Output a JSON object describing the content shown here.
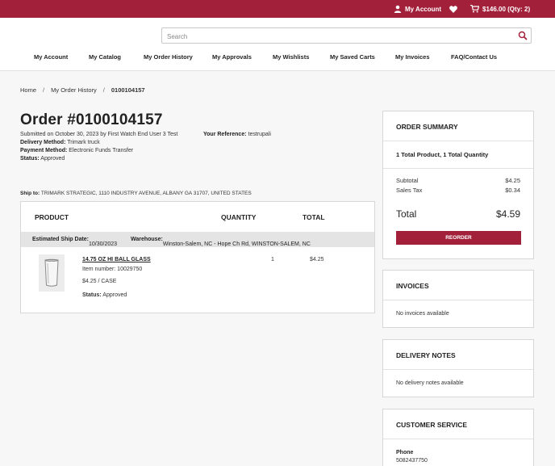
{
  "topbar": {
    "account_label": "My Account",
    "cart_label": "$146.00 (Qty: 2)",
    "colors": {
      "brand": "#a3203b"
    }
  },
  "search": {
    "placeholder": "Search",
    "value": ""
  },
  "nav": [
    "My Account",
    "My Catalog",
    "My Order History",
    "My Approvals",
    "My Wishlists",
    "My Saved Carts",
    "My Invoices",
    "FAQ/Contact Us"
  ],
  "breadcrumb": {
    "home": "Home",
    "history": "My Order History",
    "current": "0100104157"
  },
  "order": {
    "title": "Order #0100104157",
    "submitted": "Submitted on October 30, 2023 by First Watch End User 3 Test",
    "reference_label": "Your Reference:",
    "reference_value": "testrupali",
    "delivery_label": "Delivery Method:",
    "delivery_value": "Trimark truck",
    "payment_label": "Payment Method:",
    "payment_value": "Electronic Funds Transfer",
    "status_label": "Status:",
    "status_value": "Approved",
    "ship_to_label": "Ship to:",
    "ship_to_value": "TRIMARK STRATEGIC, 1110 INDUSTRY AVENUE, ALBANY GA 31707, UNITED STATES"
  },
  "items": {
    "headers": {
      "product": "PRODUCT",
      "quantity": "QUANTITY",
      "total": "TOTAL"
    },
    "ship_date_label": "Estimated Ship Date:",
    "ship_date_value": "10/30/2023",
    "warehouse_label": "Warehouse:",
    "warehouse_value": "Winston-Salem, NC - Hope Ch Rd, WINSTON-SALEM, NC",
    "products": [
      {
        "name": "14.75 OZ HI BALL GLASS",
        "item_number": "Item number: 10029750",
        "unit_price": "$4.25 / CASE",
        "status_label": "Status:",
        "status_value": "Approved",
        "quantity": "1",
        "total": "$4.25"
      }
    ]
  },
  "summary": {
    "title": "ORDER SUMMARY",
    "counts": "1 Total Product, 1 Total Quantity",
    "subtotal_label": "Subtotal",
    "subtotal_value": "$4.25",
    "tax_label": "Sales Tax",
    "tax_value": "$0.34",
    "total_label": "Total",
    "total_value": "$4.59",
    "reorder_label": "REORDER"
  },
  "invoices": {
    "title": "INVOICES",
    "empty": "No invoices available"
  },
  "delivery_notes": {
    "title": "DELIVERY NOTES",
    "empty": "No delivery notes available"
  },
  "customer_service": {
    "title": "CUSTOMER SERVICE",
    "phone_label": "Phone",
    "phone_value": "5082437750"
  }
}
